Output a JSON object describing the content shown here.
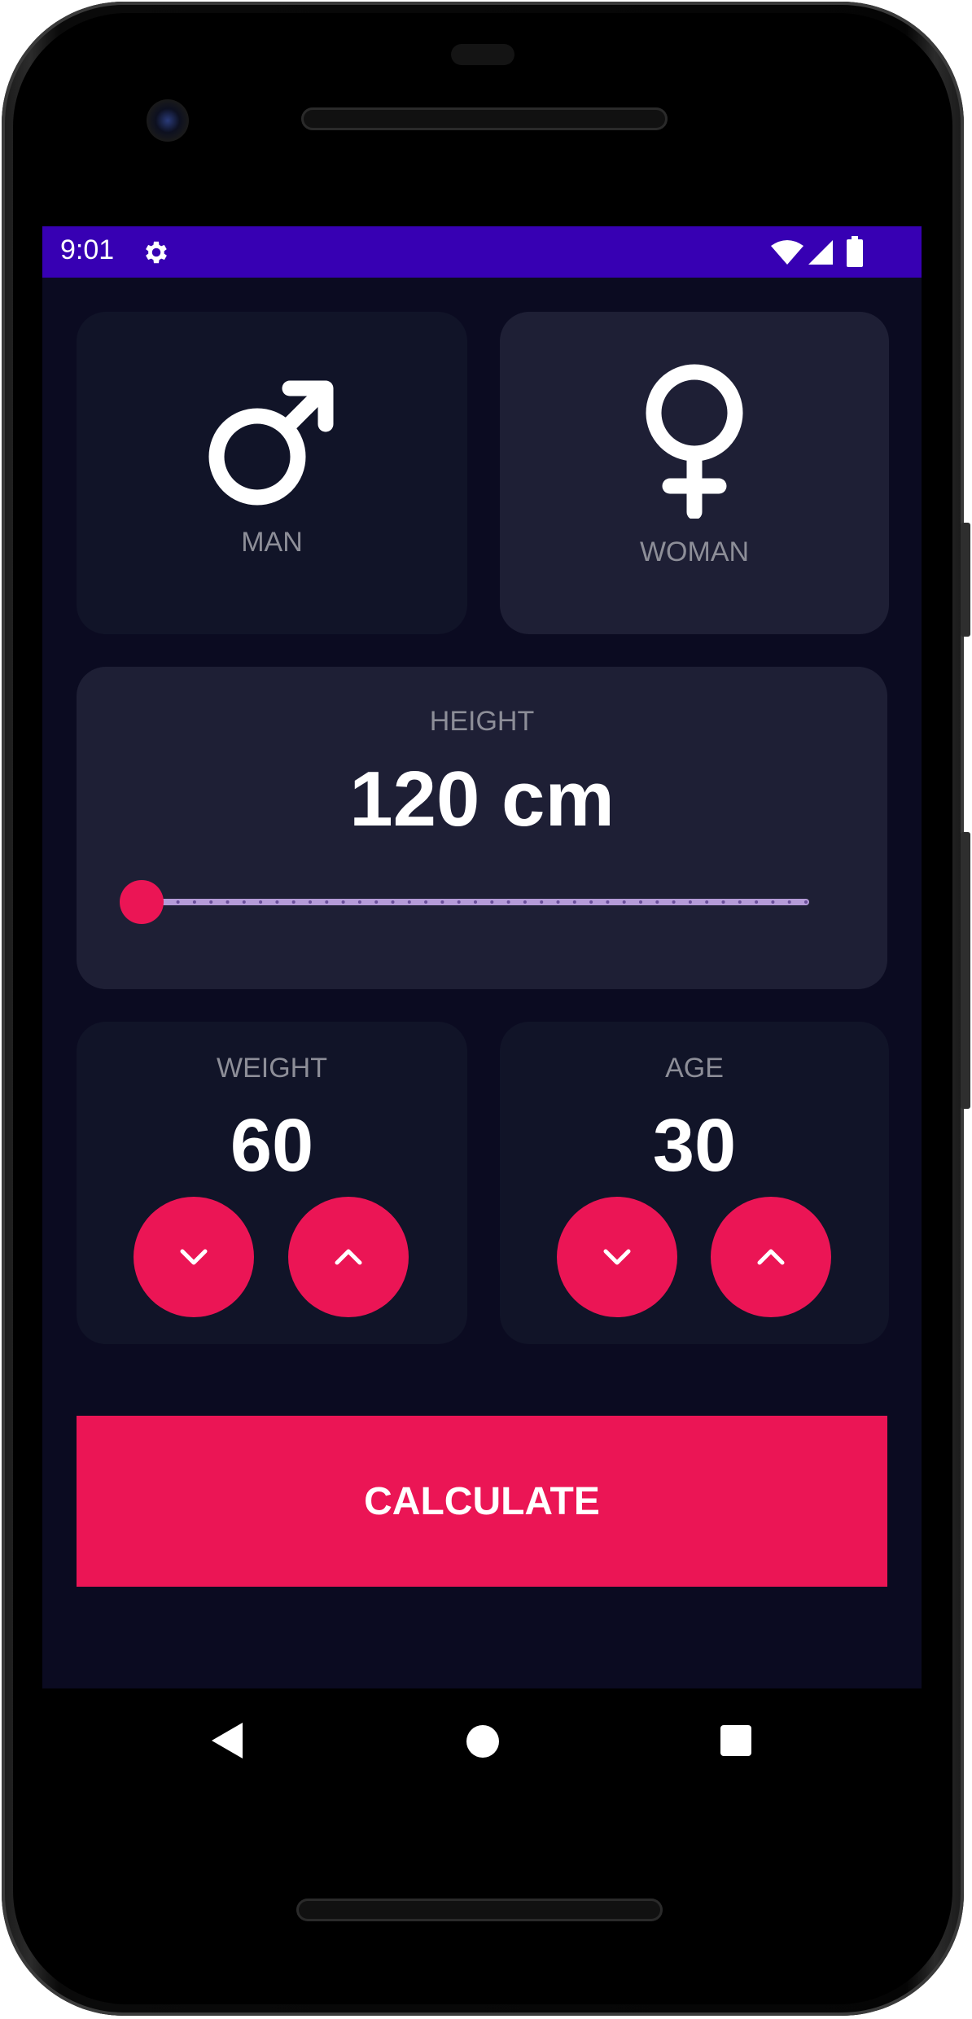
{
  "status_bar": {
    "time": "9:01",
    "icons": [
      "gear-icon",
      "wifi-icon",
      "cell-signal-icon",
      "battery-icon"
    ],
    "color": "#3700b3"
  },
  "gender": {
    "man_label": "MAN",
    "woman_label": "WOMAN",
    "man_icon": "male-symbol-icon",
    "woman_icon": "female-symbol-icon"
  },
  "height": {
    "label": "HEIGHT",
    "value_text": "120 cm",
    "slider_fraction": 0.0
  },
  "weight": {
    "label": "WEIGHT",
    "value": "60"
  },
  "age": {
    "label": "AGE",
    "value": "30"
  },
  "calculate_label": "CALCULATE",
  "nav_bar": {
    "icons": [
      "back-icon",
      "home-icon",
      "recents-icon"
    ]
  },
  "colors": {
    "background": "#0b0b21",
    "card_selected": "#111428",
    "card_unselected": "#1e1f35",
    "accent": "#eb1555",
    "label_gray": "#8d8e98"
  }
}
